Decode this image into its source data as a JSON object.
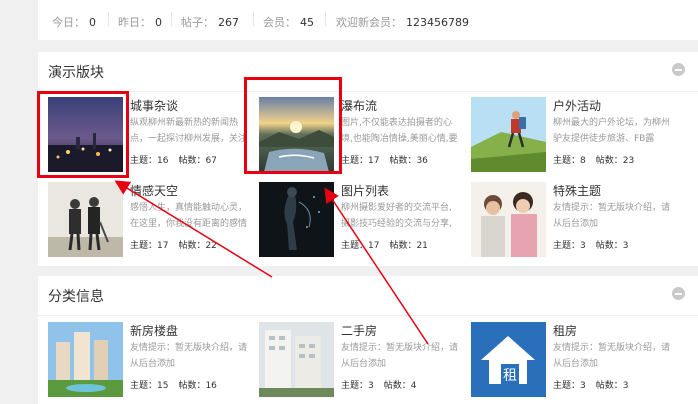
{
  "stats": {
    "today_label": "今日：",
    "today_value": "0",
    "yesterday_label": "昨日：",
    "yesterday_value": "0",
    "posts_label": "帖子：",
    "posts_value": "267",
    "members_label": "会员：",
    "members_value": "45",
    "welcome_label": "欢迎新会员：",
    "welcome_value": "123456789"
  },
  "section1": {
    "title": "演示版块",
    "forums": [
      {
        "name": "城事杂谈",
        "desc": "纵观柳州新最新热的新闻热点，一起探讨柳州发展，关注",
        "topics": "主题：16",
        "posts": "帖数：67"
      },
      {
        "name": "瀑布流",
        "desc": "图片,不仅能表达拍摄者的心境,也能陶冶情操,美丽心情,要摄人",
        "topics": "主题：17",
        "posts": "帖数：36"
      },
      {
        "name": "户外活动",
        "desc": "柳州最大的户外论坛，为柳州驴友提供徒步旅游、FB露营、",
        "topics": "主题：8",
        "posts": "帖数：23"
      },
      {
        "name": "情感天空",
        "desc": "感悟人生，真情能触动心灵，在这里，你我没有距离的感情",
        "topics": "主题：17",
        "posts": "帖数：22"
      },
      {
        "name": "图片列表",
        "desc": "柳州摄影爱好者的交流平台,摄影技巧经验的交流与分享,共同",
        "topics": "主题：17",
        "posts": "帖数：21"
      },
      {
        "name": "特殊主题",
        "desc": "友情提示：暂无版块介绍，请从后台添加",
        "topics": "主题：3",
        "posts": "帖数：3"
      }
    ]
  },
  "section2": {
    "title": "分类信息",
    "forums": [
      {
        "name": "新房楼盘",
        "desc": "友情提示：暂无版块介绍，请从后台添加",
        "topics": "主题：15",
        "posts": "帖数：16"
      },
      {
        "name": "二手房",
        "desc": "友情提示：暂无版块介绍，请从后台添加",
        "topics": "主题：3",
        "posts": "帖数：4"
      },
      {
        "name": "租房",
        "desc": "友情提示：暂无版块介绍，请从后台添加",
        "topics": "主题：3",
        "posts": "帖数：3"
      }
    ]
  },
  "rent_icon_char": "租",
  "colors": {
    "annotation": "#e60012",
    "rent_icon_bg": "#2a6fba"
  }
}
